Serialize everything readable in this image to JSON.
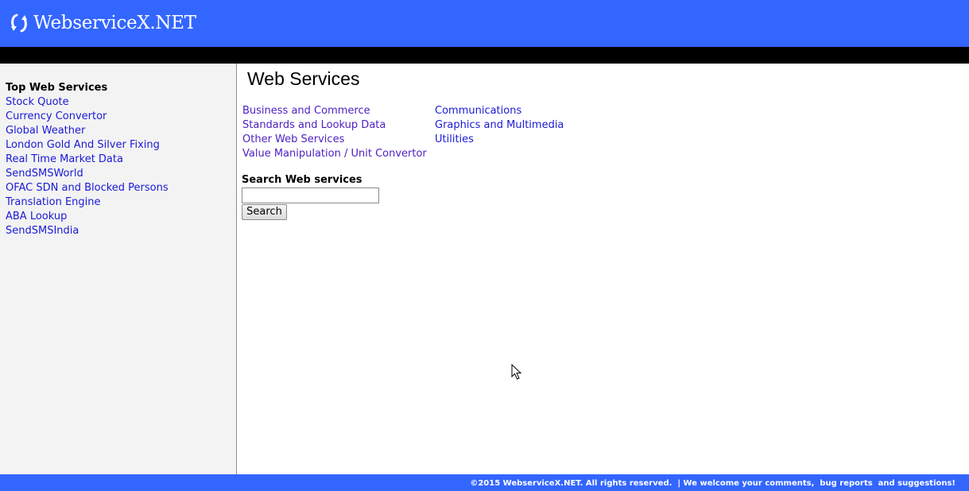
{
  "header": {
    "brand": "WebserviceX.NET",
    "logo_icon": "refresh-arrows-icon",
    "background": "#3366ff"
  },
  "sidebar": {
    "title": "Top Web Services",
    "items": [
      "Stock Quote",
      "Currency Convertor",
      "Global Weather",
      "London Gold And Silver Fixing",
      "Real Time Market Data",
      "SendSMSWorld",
      "OFAC SDN and Blocked Persons",
      "Translation Engine",
      "ABA Lookup",
      "SendSMSIndia"
    ],
    "background": "#f3f3f3",
    "link_color": "#1a1ad6"
  },
  "main": {
    "title": "Web Services",
    "categories_left": [
      "Business and Commerce",
      "Standards and Lookup Data",
      "Other Web Services",
      "Value Manipulation / Unit Convertor"
    ],
    "categories_right": [
      "Communications",
      "Graphics and Multimedia",
      "Utilities"
    ],
    "visited_link_color": "#4b1fc1"
  },
  "search": {
    "label": "Search Web services",
    "input_value": "",
    "button_label": "Search"
  },
  "footer": {
    "text": "©2015 WebserviceX.NET. All rights reserved.  | We welcome your comments,  bug reports  and suggestions!"
  }
}
